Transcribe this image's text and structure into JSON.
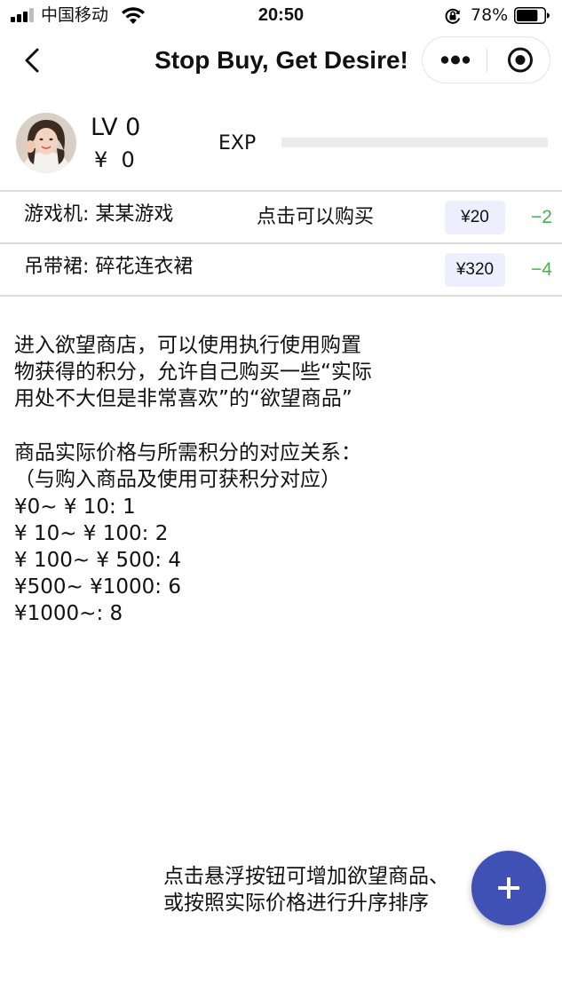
{
  "status_bar": {
    "carrier": "中国移动",
    "time": "20:50",
    "battery_percent": "78%",
    "battery_level": 0.78,
    "icons": [
      "signal-icon",
      "wifi-icon",
      "orientation-lock-icon",
      "battery-icon"
    ]
  },
  "nav": {
    "title": "Stop Buy, Get Desire!",
    "icons": [
      "back-icon",
      "more-icon",
      "close-target-icon"
    ]
  },
  "profile": {
    "level": "LV 0",
    "balance": "¥  0",
    "exp_label": "EXP",
    "exp_progress": 0
  },
  "items": [
    {
      "name": "游戏机: 某某游戏",
      "hint": "点击可以购买",
      "price": "¥20",
      "cost": "−2"
    },
    {
      "name": "吊带裙: 碎花连衣裙",
      "hint": "",
      "price": "¥320",
      "cost": "−4"
    }
  ],
  "description": [
    "进入欲望商店，可以使用执行使用购置",
    "物获得的积分，允许自己购买一些“实际",
    "用处不大但是非常喜欢”的“欲望商品”",
    "",
    "商品实际价格与所需积分的对应关系：",
    "（与购入商品及使用可获积分对应）",
    "¥0~ ¥ 10: 1",
    "¥ 10~ ¥ 100: 2",
    "¥ 100~ ¥ 500: 4",
    "¥500~ ¥1000: 6",
    "¥1000~: 8"
  ],
  "footer_hint": [
    "点击悬浮按钮可增加欲望商品、",
    "或按照实际价格进行升序排序"
  ],
  "fab": {
    "icon": "plus-icon"
  },
  "colors": {
    "accent": "#3f51b5",
    "cost_green": "#4caf50",
    "price_chip_bg": "#eeeeff",
    "divider": "#dcdcdc"
  }
}
